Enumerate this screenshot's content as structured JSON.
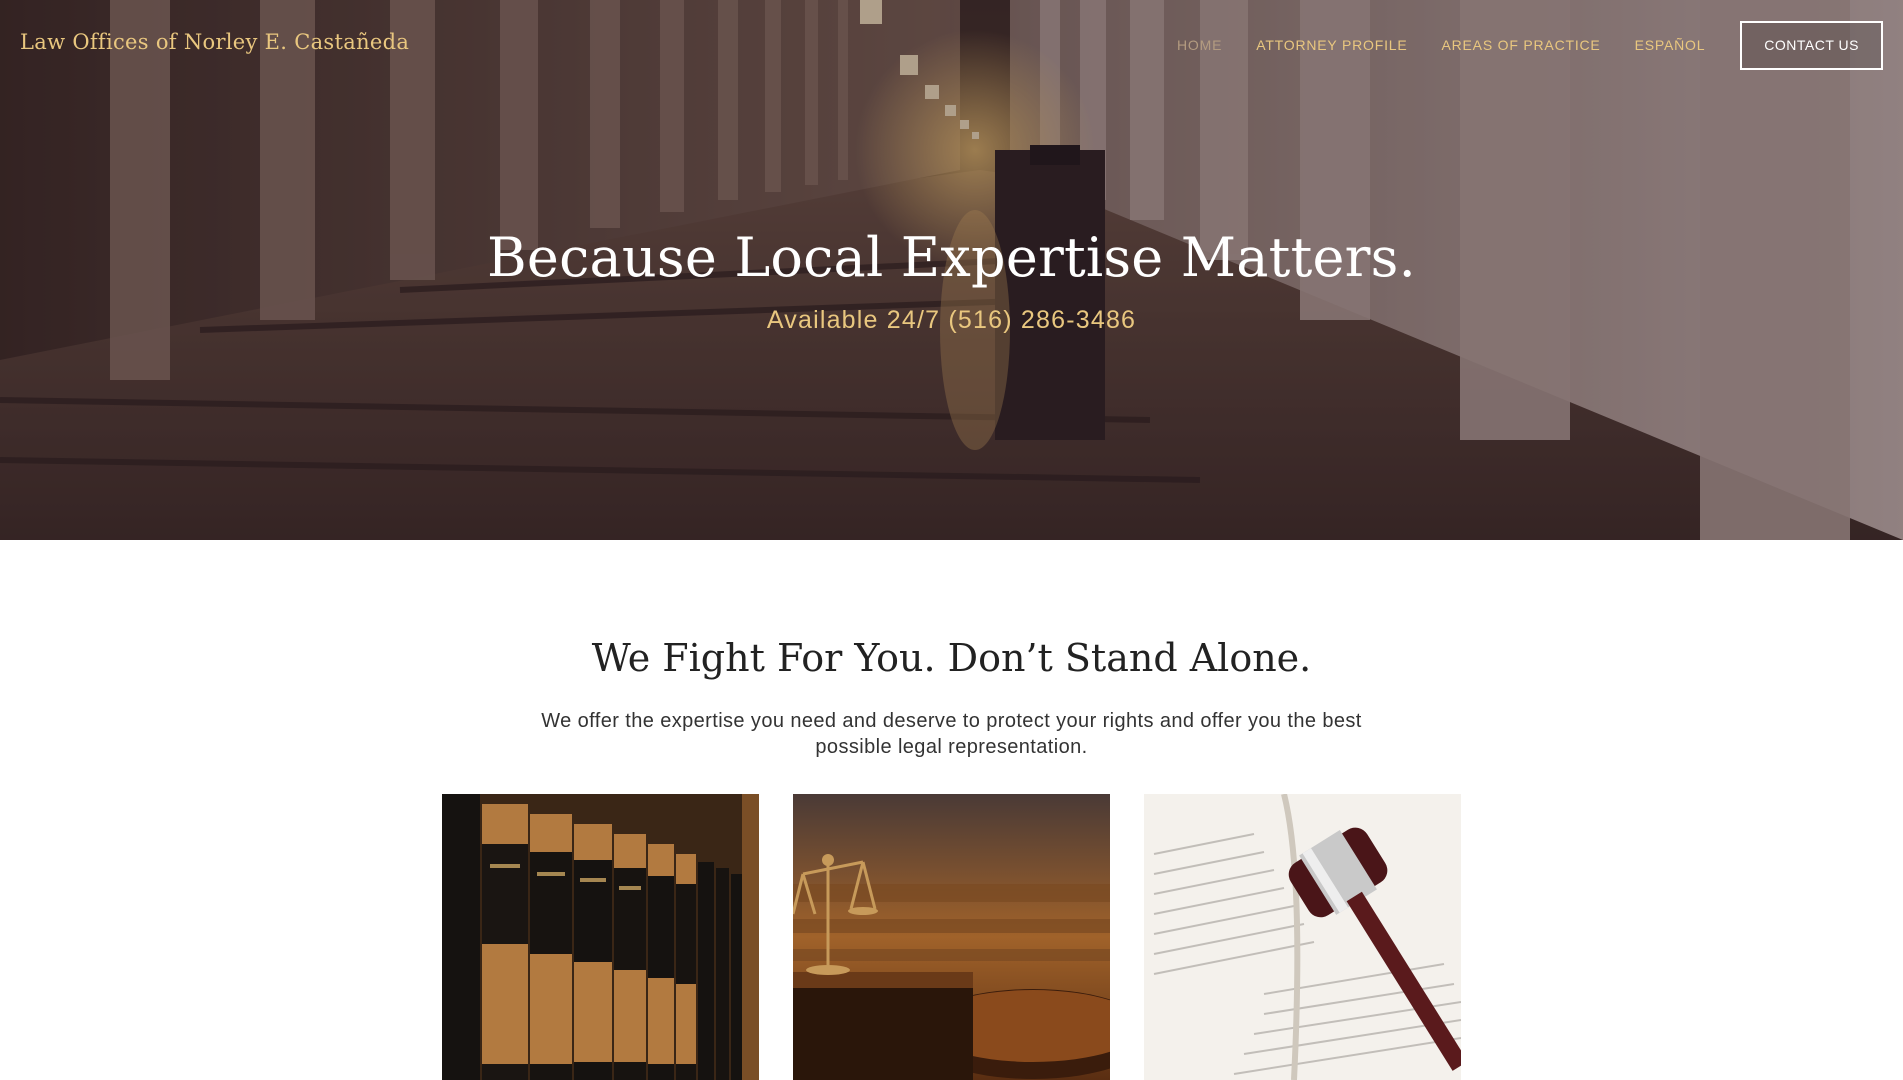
{
  "header": {
    "site_title": "Law Offices of Norley E. Castañeda",
    "nav": [
      {
        "label": "HOME",
        "active": true
      },
      {
        "label": "ATTORNEY PROFILE",
        "active": false
      },
      {
        "label": "AREAS OF PRACTICE",
        "active": false
      },
      {
        "label": "ESPAÑOL",
        "active": false
      }
    ],
    "contact_button": "CONTACT US"
  },
  "hero": {
    "headline": "Because Local Expertise Matters.",
    "subline": "Available 24/7 (516) 286-3486",
    "background": "courthouse-corridor-photo"
  },
  "intro": {
    "title": "We Fight For You. Don’t Stand Alone.",
    "text": "We offer the expertise you need and deserve to protect your rights and offer you the best possible legal representation."
  },
  "cards": [
    {
      "image": "law-books-photo"
    },
    {
      "image": "scales-of-justice-courtroom-photo"
    },
    {
      "image": "gavel-on-book-photo"
    }
  ],
  "colors": {
    "accent_gold": "#e9c77f",
    "nav_active": "#b39b80",
    "text_dark": "#222222"
  }
}
